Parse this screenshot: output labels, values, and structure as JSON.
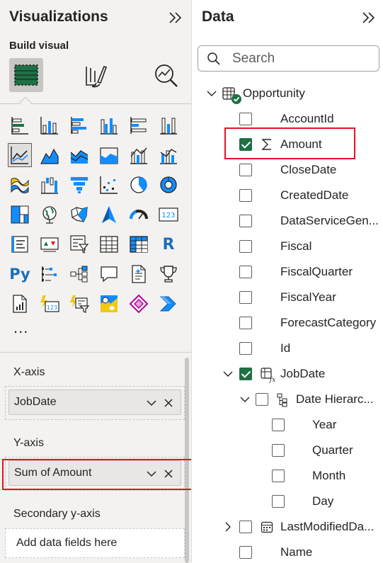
{
  "visualizations": {
    "title": "Visualizations",
    "build_visual_label": "Build visual",
    "more_label": "...",
    "x_axis": {
      "label": "X-axis",
      "field": "JobDate"
    },
    "y_axis": {
      "label": "Y-axis",
      "field": "Sum of Amount"
    },
    "secondary_y_axis": {
      "label": "Secondary y-axis",
      "placeholder": "Add data fields here"
    },
    "py_label": "Py",
    "r_label": "R",
    "card_label": "123"
  },
  "data": {
    "title": "Data",
    "search_placeholder": "Search",
    "table": {
      "name": "Opportunity",
      "fields": [
        {
          "name": "AccountId",
          "checked": false
        },
        {
          "name": "Amount",
          "checked": true,
          "icon": "sigma-icon"
        },
        {
          "name": "CloseDate",
          "checked": false
        },
        {
          "name": "CreatedDate",
          "checked": false
        },
        {
          "name": "DataServiceGen...",
          "checked": false
        },
        {
          "name": "Fiscal",
          "checked": false
        },
        {
          "name": "FiscalQuarter",
          "checked": false
        },
        {
          "name": "FiscalYear",
          "checked": false
        },
        {
          "name": "ForecastCategory",
          "checked": false
        },
        {
          "name": "Id",
          "checked": false
        }
      ],
      "job_date": {
        "name": "JobDate",
        "checked": true,
        "hierarchy": {
          "name": "Date Hierarc...",
          "levels": [
            "Year",
            "Quarter",
            "Month",
            "Day"
          ]
        }
      },
      "last_modified": {
        "name": "LastModifiedDa..."
      },
      "name_field": {
        "name": "Name"
      }
    }
  },
  "colors": {
    "pane_bg": "#f3f2f1",
    "accent_teal": "#118dff",
    "checkbox_green": "#1e7145",
    "highlight_red": "#e81123"
  }
}
